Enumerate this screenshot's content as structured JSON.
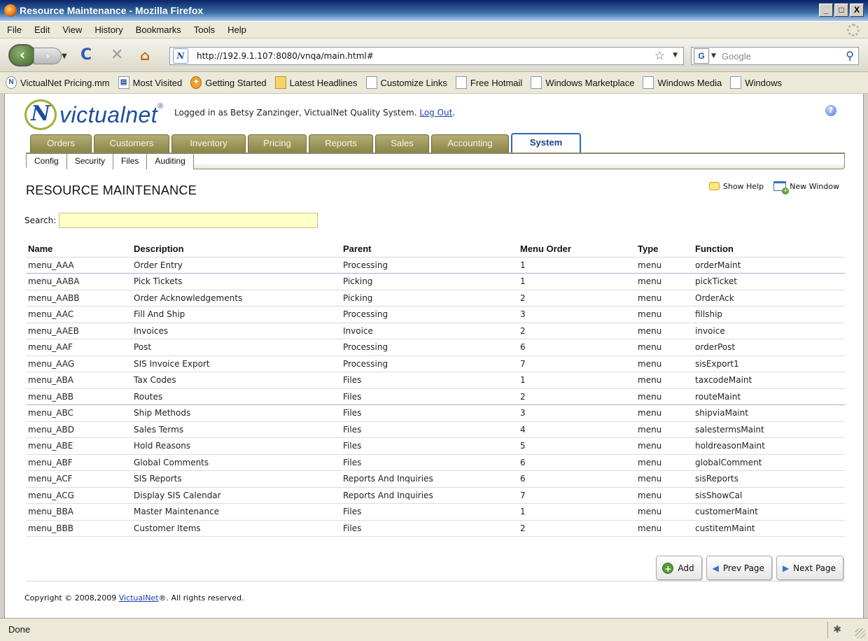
{
  "window": {
    "title": "Resource Maintenance - Mozilla Firefox",
    "minimize": "_",
    "maximize": "□",
    "close": "X"
  },
  "menubar": [
    "File",
    "Edit",
    "View",
    "History",
    "Bookmarks",
    "Tools",
    "Help"
  ],
  "navbar": {
    "url": "http://192.9.1.107:8080/vnqa/main.html#",
    "search_placeholder": "Google"
  },
  "bookmarks": [
    {
      "label": "VictualNet Pricing.mm",
      "icon": "victualnet-icon"
    },
    {
      "label": "Most Visited",
      "icon": "most-visited-icon"
    },
    {
      "label": "Getting Started",
      "icon": "getting-started-icon"
    },
    {
      "label": "Latest Headlines",
      "icon": "rss-icon"
    },
    {
      "label": "Customize Links",
      "icon": "page-icon"
    },
    {
      "label": "Free Hotmail",
      "icon": "page-icon"
    },
    {
      "label": "Windows Marketplace",
      "icon": "page-icon"
    },
    {
      "label": "Windows Media",
      "icon": "page-icon"
    },
    {
      "label": "Windows",
      "icon": "page-icon"
    }
  ],
  "app": {
    "logo_text": "victualnet",
    "logged_in_prefix": "Logged in as Betsy Zanzinger, VictualNet Quality System.",
    "logout": "Log Out",
    "logged_in_suffix": "."
  },
  "tabs": [
    "Orders",
    "Customers",
    "Inventory",
    "Pricing",
    "Reports",
    "Sales",
    "Accounting",
    "System"
  ],
  "active_tab": "System",
  "subtabs": [
    "Config",
    "Security",
    "Files",
    "Auditing"
  ],
  "page": {
    "title": "RESOURCE MAINTENANCE",
    "show_help": "Show Help",
    "new_window": "New Window",
    "search_label": "Search:",
    "search_value": ""
  },
  "table": {
    "headers": [
      "Name",
      "Description",
      "Parent",
      "Menu Order",
      "Type",
      "Function"
    ],
    "rows": [
      [
        "menu_AAA",
        "Order Entry",
        "Processing",
        "1",
        "menu",
        "orderMaint"
      ],
      [
        "menu_AABA",
        "Pick Tickets",
        "Picking",
        "1",
        "menu",
        "pickTicket"
      ],
      [
        "menu_AABB",
        "Order Acknowledgements",
        "Picking",
        "2",
        "menu",
        "OrderAck"
      ],
      [
        "menu_AAC",
        "Fill And Ship",
        "Processing",
        "3",
        "menu",
        "fillship"
      ],
      [
        "menu_AAEB",
        "Invoices",
        "Invoice",
        "2",
        "menu",
        "invoice"
      ],
      [
        "menu_AAF",
        "Post",
        "Processing",
        "6",
        "menu",
        "orderPost"
      ],
      [
        "menu_AAG",
        "SIS Invoice Export",
        "Processing",
        "7",
        "menu",
        "sisExport1"
      ],
      [
        "menu_ABA",
        "Tax Codes",
        "Files",
        "1",
        "menu",
        "taxcodeMaint"
      ],
      [
        "menu_ABB",
        "Routes",
        "Files",
        "2",
        "menu",
        "routeMaint"
      ],
      [
        "menu_ABC",
        "Ship Methods",
        "Files",
        "3",
        "menu",
        "shipviaMaint"
      ],
      [
        "menu_ABD",
        "Sales Terms",
        "Files",
        "4",
        "menu",
        "salestermsMaint"
      ],
      [
        "menu_ABE",
        "Hold Reasons",
        "Files",
        "5",
        "menu",
        "holdreasonMaint"
      ],
      [
        "menu_ABF",
        "Global Comments",
        "Files",
        "6",
        "menu",
        "globalComment"
      ],
      [
        "menu_ACF",
        "SIS Reports",
        "Reports And Inquiries",
        "6",
        "menu",
        "sisReports"
      ],
      [
        "menu_ACG",
        "Display SIS Calendar",
        "Reports And Inquiries",
        "7",
        "menu",
        "sisShowCal"
      ],
      [
        "menu_BBA",
        "Master Maintenance",
        "Files",
        "1",
        "menu",
        "customerMaint"
      ],
      [
        "menu_BBB",
        "Customer Items",
        "Files",
        "2",
        "menu",
        "custitemMaint"
      ]
    ]
  },
  "buttons": {
    "add": "Add",
    "prev": "Prev Page",
    "next": "Next Page"
  },
  "footer": {
    "prefix": "Copyright © 2008,2009 ",
    "link": "VictualNet",
    "suffix": "®. All rights reserved."
  },
  "status": "Done"
}
